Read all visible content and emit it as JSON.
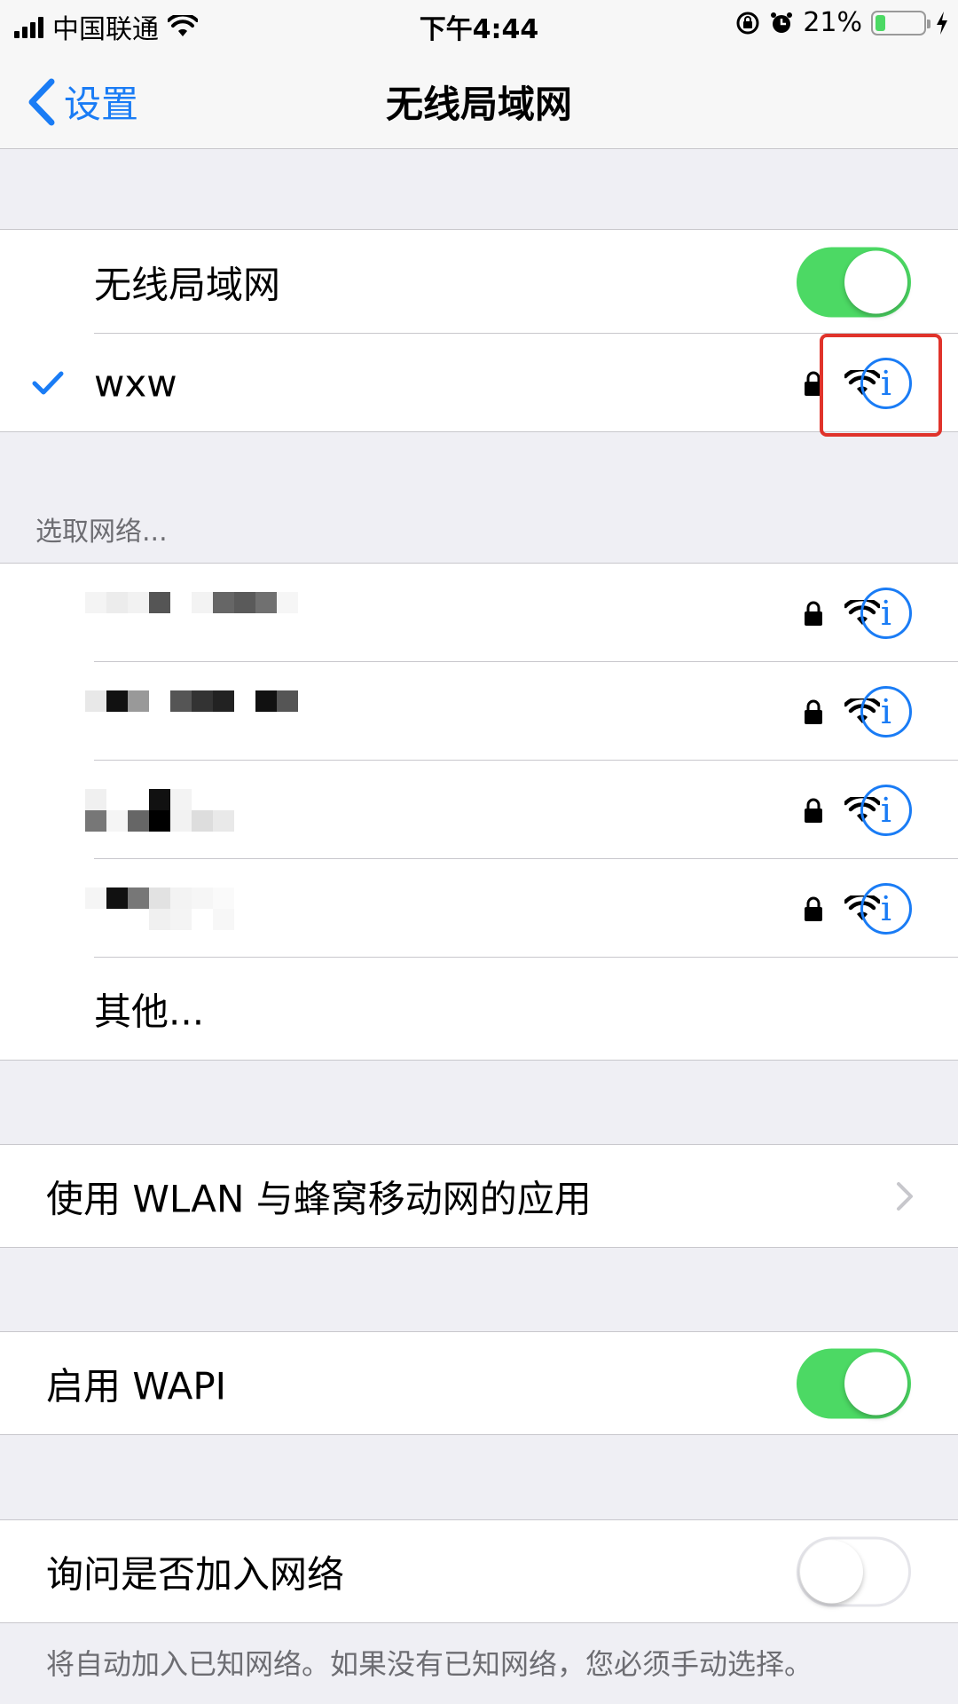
{
  "status_bar": {
    "carrier": "中国联通",
    "time": "下午4:44",
    "battery_percent": "21%",
    "battery_level": 0.21,
    "icons": [
      "signal-icon",
      "wifi-icon",
      "orientation-lock-icon",
      "alarm-icon",
      "battery-icon",
      "charging-icon"
    ]
  },
  "nav": {
    "back_label": "设置",
    "title": "无线局域网"
  },
  "wifi_toggle": {
    "label": "无线局域网",
    "on": true
  },
  "connected_network": {
    "name": "wxw",
    "secured": true
  },
  "choose_network": {
    "header": "选取网络...",
    "networks": [
      {
        "name": "",
        "secured": true
      },
      {
        "name": "",
        "secured": true
      },
      {
        "name": "",
        "secured": true
      },
      {
        "name": "",
        "secured": true
      }
    ],
    "other_label": "其他..."
  },
  "apps_row": {
    "label": "使用 WLAN 与蜂窝移动网的应用"
  },
  "wapi_toggle": {
    "label": "启用 WAPI",
    "on": true
  },
  "ask_join": {
    "label": "询问是否加入网络",
    "on": false,
    "footer": "将自动加入已知网络。如果没有已知网络，您必须手动选择。"
  },
  "colors": {
    "accent": "#1a7cf5",
    "toggle_on": "#4cd964",
    "highlight": "#e0332b"
  }
}
